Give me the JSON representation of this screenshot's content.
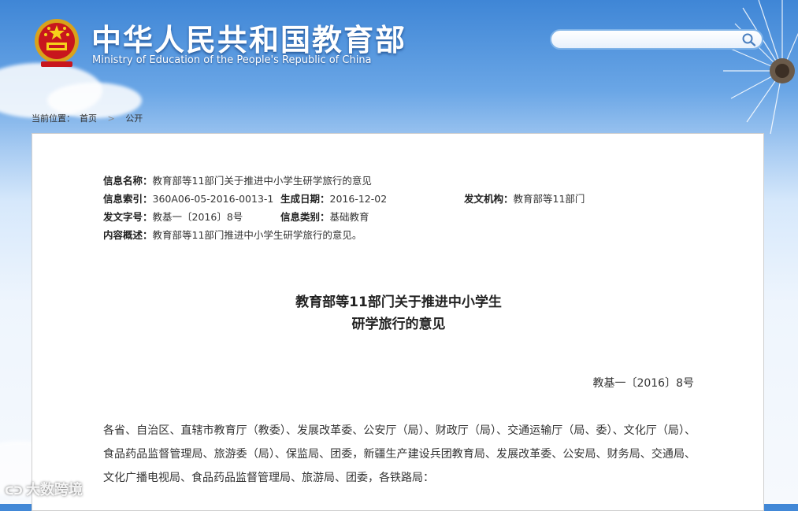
{
  "header": {
    "title": "中华人民共和国教育部",
    "subtitle": "Ministry of Education of the People's Republic of China"
  },
  "search": {
    "value": "",
    "placeholder": ""
  },
  "breadcrumb": {
    "prefix": "当前位置：",
    "home": "首页",
    "separator": ">",
    "current": "公开"
  },
  "meta": {
    "name_label": "信息名称：",
    "name_value": "教育部等11部门关于推进中小学生研学旅行的意见",
    "index_label": "信息索引：",
    "index_value": "360A06-05-2016-0013-1",
    "date_label": "生成日期：",
    "date_value": "2016-12-02",
    "org_label": "发文机构：",
    "org_value": "教育部等11部门",
    "docno_label": "发文字号：",
    "docno_value": "教基一〔2016〕8号",
    "category_label": "信息类别：",
    "category_value": "基础教育",
    "summary_label": "内容概述：",
    "summary_value": "教育部等11部门推进中小学生研学旅行的意见。"
  },
  "doc": {
    "title_line1": "教育部等11部门关于推进中小学生",
    "title_line2": "研学旅行的意见",
    "number": "教基一〔2016〕8号",
    "body": "各省、自治区、直辖市教育厅（教委）、发展改革委、公安厅（局）、财政厅（局）、交通运输厅（局、委）、文化厅（局）、食品药品监督管理局、旅游委（局）、保监局、团委，新疆生产建设兵团教育局、发展改革委、公安局、财务局、交通局、文化广播电视局、食品药品监督管理局、旅游局、团委，各铁路局："
  },
  "watermark": "大数跨境",
  "colors": {
    "sky_top": "#3f86d6",
    "panel_border": "#cfcfcf",
    "search_border": "#7fb3e8"
  }
}
